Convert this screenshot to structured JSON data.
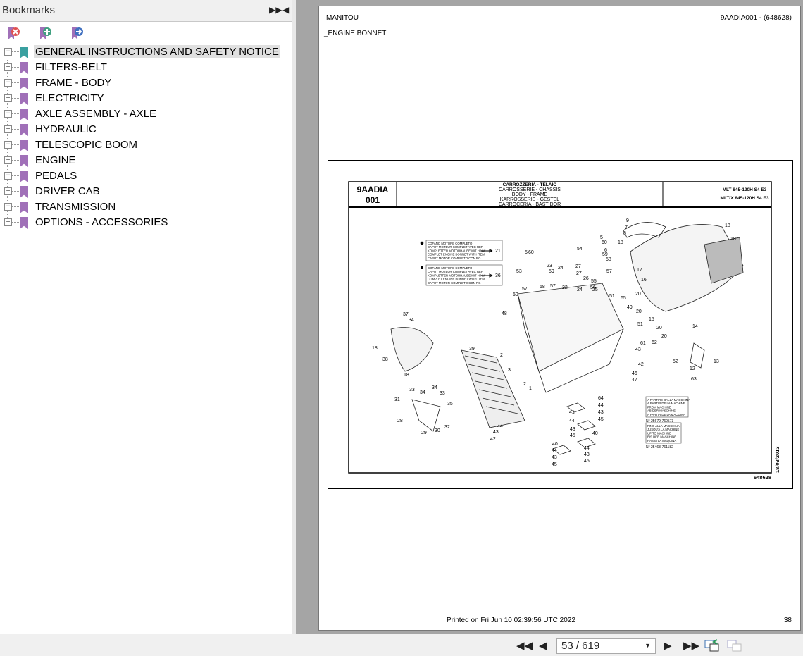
{
  "sidebar": {
    "title": "Bookmarks",
    "items": [
      {
        "label": "GENERAL INSTRUCTIONS AND SAFETY NOTICE",
        "selected": true
      },
      {
        "label": "FILTERS-BELT"
      },
      {
        "label": "FRAME - BODY"
      },
      {
        "label": "ELECTRICITY"
      },
      {
        "label": "AXLE ASSEMBLY - AXLE"
      },
      {
        "label": "HYDRAULIC"
      },
      {
        "label": "TELESCOPIC BOOM"
      },
      {
        "label": "ENGINE"
      },
      {
        "label": "PEDALS"
      },
      {
        "label": "DRIVER CAB"
      },
      {
        "label": "TRANSMISSION"
      },
      {
        "label": "OPTIONS - ACCESSORIES"
      }
    ]
  },
  "page": {
    "brand": "MANITOU",
    "ref": "9AADIA001 - (648628)",
    "section": "_ENGINE BONNET",
    "code1": "9AADIA",
    "code2": "001",
    "titles": [
      "CARROZZERIA - TELAIO",
      "CARROSSERIE - CHASSIS",
      "BODY - FRAME",
      "KARROSSERIE - GESTEL",
      "CARROCERIA - BASTIDOR"
    ],
    "models": [
      "MLT 845-120H S4 E3",
      "MLT-X 845-120H S4 E3"
    ],
    "note1": [
      "COFANO MOTORE COMPLETO",
      "CAPOT MOTEUR COMPLET AVEC REP",
      "KOMPLETTER MOTORHAUBE MIT HINW",
      "COMPLET ENGINE BONNET WITH ITEM",
      "CAPOT MOTOR COMPLETO CON RG"
    ],
    "note1_ref": "21",
    "note2": [
      "COFANO MOTORE COMPLETO",
      "CAPOT MOTEUR COMPLET AVEC REP",
      "KOMPLETTER MOTORHAUBE MIT HINW",
      "COMPLET ENGINE BONNET WITH ITEM",
      "CAPOT MOTOR COMPLETO CON RG"
    ],
    "note2_ref": "36",
    "from": [
      "A PARTIRE DALLA MACCHINA",
      "A PARTIR DE LA MACHINE",
      "FROM MACHINE",
      "AB DER MASCHINE",
      "A PARTIR DE LA MAQUINA"
    ],
    "from_no": "N° 25679-760573",
    "upto": [
      "FINO ALLA MACCHINA",
      "JUSQU'A LA MACHINE",
      "UP TO MACHINE",
      "BIS DER MASCHINE",
      "HASTA LA MAQUINA"
    ],
    "upto_no": "N° 25463-761182",
    "date": "18/03/2013",
    "drawing_no": "648628",
    "callouts": [
      "9",
      "7",
      "8",
      "18",
      "18",
      "5",
      "60",
      "6",
      "54",
      "59",
      "58",
      "57",
      "18",
      "17",
      "16",
      "60",
      "5",
      "23",
      "59",
      "24",
      "27",
      "27",
      "26",
      "55",
      "56",
      "53",
      "57",
      "58",
      "57",
      "22",
      "24",
      "25",
      "50",
      "51",
      "65",
      "49",
      "20",
      "20",
      "15",
      "20",
      "51",
      "20",
      "14",
      "48",
      "37",
      "34",
      "18",
      "38",
      "18",
      "39",
      "2",
      "3",
      "2",
      "1",
      "61",
      "62",
      "43",
      "42",
      "52",
      "46",
      "47",
      "13",
      "12",
      "63",
      "33",
      "34",
      "34",
      "33",
      "31",
      "35",
      "28",
      "29",
      "30",
      "32",
      "41",
      "44",
      "43",
      "45",
      "64",
      "44",
      "43",
      "45",
      "40",
      "44",
      "43",
      "42",
      "40",
      "44",
      "43",
      "45",
      "44",
      "43",
      "45"
    ],
    "printed": "Printed on  Fri Jun 10 02:39:56 UTC 2022",
    "page_num": "38"
  },
  "nav": {
    "page_value": "53 / 619"
  }
}
